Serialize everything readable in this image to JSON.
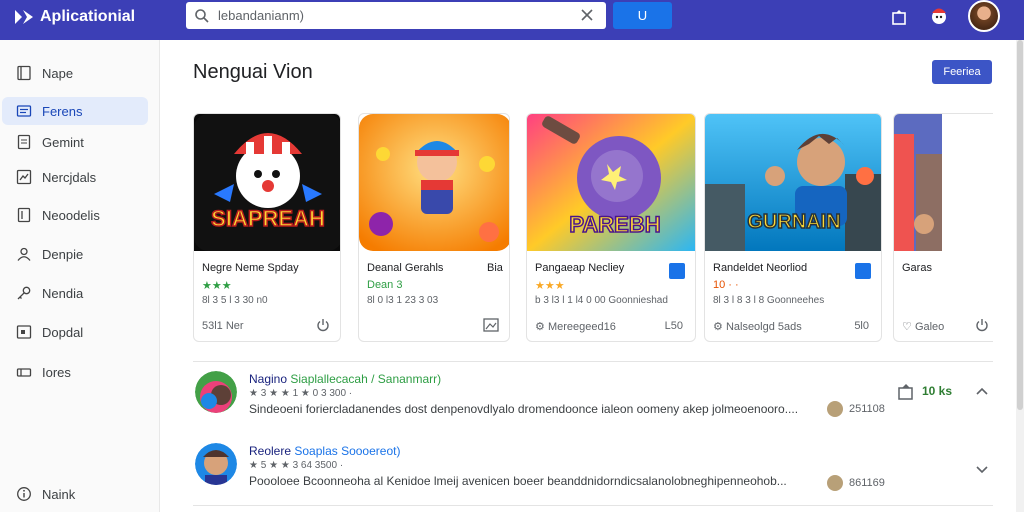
{
  "header": {
    "app_title": "Aplicationial",
    "search_placeholder": "lebandanianm)",
    "search_button": "U"
  },
  "sidebar": {
    "items": [
      {
        "label": "Nape",
        "icon": "bookmark-icon"
      },
      {
        "label": "Ferens",
        "icon": "list-icon"
      },
      {
        "label": "Gemint",
        "icon": "document-icon"
      },
      {
        "label": "Nercjdals",
        "icon": "chart-icon"
      },
      {
        "label": "Neoodelis",
        "icon": "file-icon"
      },
      {
        "label": "Denpie",
        "icon": "user-icon"
      },
      {
        "label": "Nendia",
        "icon": "key-icon"
      },
      {
        "label": "Dopdal",
        "icon": "window-icon"
      },
      {
        "label": "Iores",
        "icon": "tag-icon"
      }
    ],
    "footer_item": "Naink"
  },
  "main": {
    "title": "Nenguai Vion",
    "preview_button": "Feeriea"
  },
  "cards": [
    {
      "art_text": "SIAPREAH",
      "title": "Negre Neme  Spday",
      "rating": "★★★",
      "meta": "8l 3 5 l 3 30 n0",
      "footer": "53l1 Ner"
    },
    {
      "art_text": "",
      "title": "Deanal Gerahls",
      "title_extra": "Bia",
      "rating": "Dean 3",
      "meta": "8l 0 l3 1 23 3 03",
      "footer": ""
    },
    {
      "art_text": "PAREBH",
      "title": "Pangaeap Necliey",
      "rating": "★★★",
      "meta": "b 3 l3 l 1 l4 0 00 Goonnieshad",
      "footer": "Mereegeed16",
      "footer_right": "L50"
    },
    {
      "art_text": "GURNAIN",
      "title": "Randeldet Neorliod",
      "rating": "10 · ·",
      "meta": "8l 3 l 8 3 l 8 Goonneehes",
      "footer": "Nalseolgd 5ads",
      "footer_right": "5l0"
    },
    {
      "art_text": "",
      "title": "Garas",
      "rating": "",
      "meta": "",
      "footer": "Galeo"
    }
  ],
  "reviews": [
    {
      "name": "Nagino",
      "source": "Siaplallecacah / Sananmarr)",
      "meta": "★ 3 ★ ★ 1 ★ 0 3 300 ·",
      "body": "Sindeoeni foriercladanendes dost denpenovdlyalo dromendoonce ialeon oomeny akep jolmeoenooro....",
      "date": "251108",
      "count": "10 ks"
    },
    {
      "name": "Reolere",
      "source": "Soaplas Soooereot)",
      "meta": "★ 5 ★ ★ 3 64 3500 ·",
      "body": "Poooloee Bcoonneoha al Kenidoe lmeij avenicen boeer beanddnidorndicsalanolobneghipenneohob...",
      "date": "861169"
    }
  ],
  "colors": {
    "brand": "#3c3fb6",
    "accent": "#1a73e8",
    "rating": "#2e9e44"
  }
}
